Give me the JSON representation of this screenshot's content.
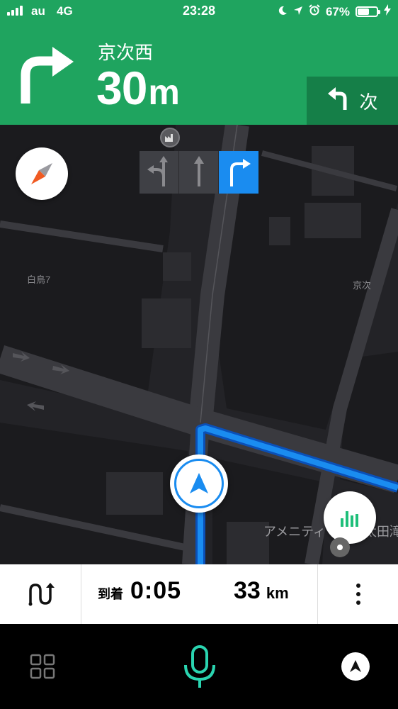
{
  "status_bar": {
    "carrier": "au",
    "network": "4G",
    "time": "23:28",
    "battery_percent": "67%",
    "battery_level": 0.67
  },
  "guidance": {
    "street_name": "京次西",
    "distance_value": "30",
    "distance_unit": "m",
    "next_label": "次",
    "turn_direction": "right",
    "next_turn_direction": "left"
  },
  "lanes": [
    {
      "icon": "left-straight-lane-icon",
      "active": false
    },
    {
      "icon": "straight-lane-icon",
      "active": false
    },
    {
      "icon": "right-turn-lane-icon",
      "active": true
    }
  ],
  "map": {
    "labels": [
      "白鳥7",
      "京次",
      "アメニティ",
      "太田滝"
    ]
  },
  "trip_info": {
    "arrival_label": "到着",
    "arrival_value": "0:05",
    "distance_value": "33",
    "distance_unit": "km"
  },
  "colors": {
    "brand_green": "#1fa45f",
    "route_blue": "#1a8cf0",
    "mic_teal": "#2ad4b0"
  }
}
